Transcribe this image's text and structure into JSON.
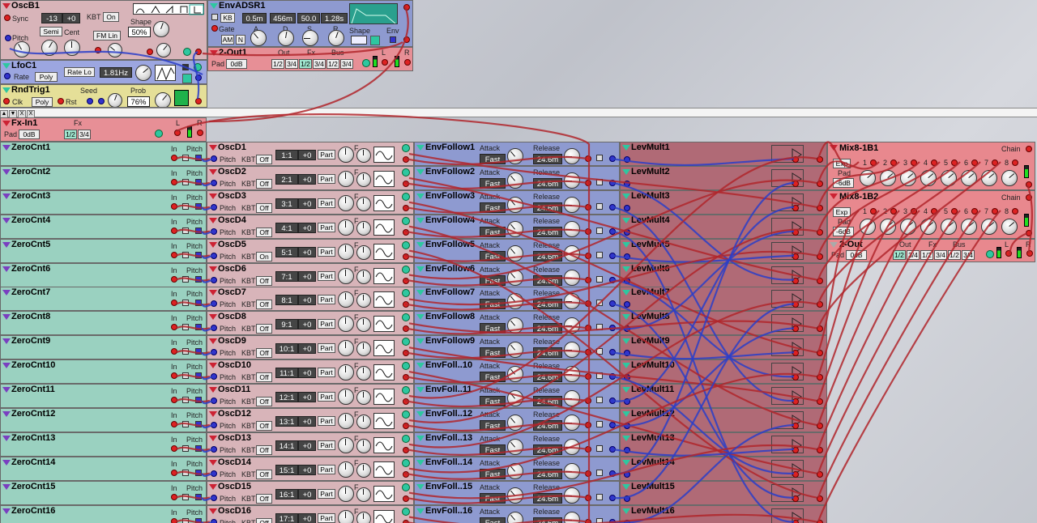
{
  "colors": {
    "osc": "#d8b4b9",
    "env": "#8e9ad0",
    "lfo": "#9ca6e0",
    "rnd": "#e5df98",
    "out": "#e78f96",
    "zero": "#9ad1c0",
    "follow": "#8e9ad0",
    "lev": "#b06a76",
    "mix": "#e8888e",
    "cable_red": "#b0262c",
    "cable_blue": "#2b3ec8"
  },
  "oscb1": {
    "title": "OscB1",
    "sync": "Sync",
    "coarse": "-13",
    "fine": "+0",
    "kbt": "KBT",
    "kbt_val": "On",
    "shape": "Shape",
    "shape_val": "50%",
    "semi": "Semi",
    "cent": "Cent",
    "pitch": "Pitch",
    "fm": "FM Lin"
  },
  "envadsr1": {
    "title": "EnvADSR1",
    "kb": "KB",
    "attack": "0.5m",
    "decay": "456m",
    "sustain": "50.0",
    "release": "1.28s",
    "gate": "Gate",
    "a": "A",
    "d": "D",
    "s": "S",
    "r": "R",
    "am": "AM",
    "n": "N",
    "shape": "Shape",
    "env": "Env"
  },
  "out2": {
    "title": "2-Out1",
    "pad": "Pad",
    "pad_val": "0dB",
    "out": "Out",
    "fx": "Fx",
    "bus": "Bus",
    "o12": "1/2",
    "o34": "3/4",
    "f12": "1/2",
    "f34": "3/4",
    "b12": "1/2",
    "b34": "3/4",
    "l": "L",
    "r": "R"
  },
  "lfoc1": {
    "title": "LfoC1",
    "rate": "Rate",
    "poly": "Poly",
    "ratelo": "Rate Lo",
    "freq": "1.81Hz"
  },
  "rndtrig1": {
    "title": "RndTrig1",
    "seed": "Seed",
    "prob": "Prob",
    "clk": "Clk",
    "poly": "Poly",
    "rst": "Rst",
    "prob_val": "76%"
  },
  "toolbar": {
    "b1": "▲",
    "b2": "▼",
    "b3": "X",
    "b4": "X"
  },
  "fxin": {
    "title": "Fx-In1",
    "fx": "Fx",
    "pad": "Pad",
    "pad_val": "0dB",
    "f12": "1/2",
    "f34": "3/4",
    "l": "L",
    "r": "R"
  },
  "rows": [
    {
      "zero": "ZeroCnt1",
      "osc": "OscD1",
      "ratio": "1:1",
      "fine": "+0",
      "kbt": "Off",
      "ef": "EnvFollow1",
      "lev": "LevMult1"
    },
    {
      "zero": "ZeroCnt2",
      "osc": "OscD2",
      "ratio": "2:1",
      "fine": "+0",
      "kbt": "Off",
      "ef": "EnvFollow2",
      "lev": "LevMult2"
    },
    {
      "zero": "ZeroCnt3",
      "osc": "OscD3",
      "ratio": "3:1",
      "fine": "+0",
      "kbt": "Off",
      "ef": "EnvFollow3",
      "lev": "LevMult3"
    },
    {
      "zero": "ZeroCnt4",
      "osc": "OscD4",
      "ratio": "4:1",
      "fine": "+0",
      "kbt": "Off",
      "ef": "EnvFollow4",
      "lev": "LevMult4"
    },
    {
      "zero": "ZeroCnt5",
      "osc": "OscD5",
      "ratio": "5:1",
      "fine": "+0",
      "kbt": "On",
      "ef": "EnvFollow5",
      "lev": "LevMult5"
    },
    {
      "zero": "ZeroCnt6",
      "osc": "OscD6",
      "ratio": "7:1",
      "fine": "+0",
      "kbt": "Off",
      "ef": "EnvFollow6",
      "lev": "LevMult6"
    },
    {
      "zero": "ZeroCnt7",
      "osc": "OscD7",
      "ratio": "8:1",
      "fine": "+0",
      "kbt": "Off",
      "ef": "EnvFollow7",
      "lev": "LevMult7"
    },
    {
      "zero": "ZeroCnt8",
      "osc": "OscD8",
      "ratio": "9:1",
      "fine": "+0",
      "kbt": "Off",
      "ef": "EnvFollow8",
      "lev": "LevMult8"
    },
    {
      "zero": "ZeroCnt9",
      "osc": "OscD9",
      "ratio": "10:1",
      "fine": "+0",
      "kbt": "Off",
      "ef": "EnvFollow9",
      "lev": "LevMult9"
    },
    {
      "zero": "ZeroCnt10",
      "osc": "OscD10",
      "ratio": "11:1",
      "fine": "+0",
      "kbt": "Off",
      "ef": "EnvFoll..10",
      "lev": "LevMult10"
    },
    {
      "zero": "ZeroCnt11",
      "osc": "OscD11",
      "ratio": "12:1",
      "fine": "+0",
      "kbt": "Off",
      "ef": "EnvFoll..11",
      "lev": "LevMult11"
    },
    {
      "zero": "ZeroCnt12",
      "osc": "OscD12",
      "ratio": "13:1",
      "fine": "+0",
      "kbt": "Off",
      "ef": "EnvFoll..12",
      "lev": "LevMult12"
    },
    {
      "zero": "ZeroCnt13",
      "osc": "OscD13",
      "ratio": "14:1",
      "fine": "+0",
      "kbt": "Off",
      "ef": "EnvFoll..13",
      "lev": "LevMult13"
    },
    {
      "zero": "ZeroCnt14",
      "osc": "OscD14",
      "ratio": "15:1",
      "fine": "+0",
      "kbt": "Off",
      "ef": "EnvFoll..14",
      "lev": "LevMult14"
    },
    {
      "zero": "ZeroCnt15",
      "osc": "OscD15",
      "ratio": "16:1",
      "fine": "+0",
      "kbt": "Off",
      "ef": "EnvFoll..15",
      "lev": "LevMult15"
    },
    {
      "zero": "ZeroCnt16",
      "osc": "OscD16",
      "ratio": "17:1",
      "fine": "+0",
      "kbt": "Off",
      "ef": "EnvFoll..16",
      "lev": "LevMult16"
    }
  ],
  "row_labels": {
    "in": "In",
    "pitch": "Pitch",
    "part": "Part",
    "kbt": "KBT",
    "attack": "Attack",
    "release": "Release",
    "fast": "Fast",
    "release_val": "24.6m",
    "f": "F"
  },
  "mix1": {
    "title": "Mix8-1B1",
    "chain": "Chain",
    "exp": "Exp",
    "pad": "Pad",
    "pad_val": "-6dB",
    "n1": "1",
    "n2": "2",
    "n3": "3",
    "n4": "4",
    "n5": "5",
    "n6": "6",
    "n7": "7",
    "n8": "8"
  },
  "mix2": {
    "title": "Mix8-1B2",
    "chain": "Chain",
    "exp": "Exp",
    "pad": "Pad",
    "pad_val": "-6dB",
    "n1": "1",
    "n2": "2",
    "n3": "3",
    "n4": "4",
    "n5": "5",
    "n6": "6",
    "n7": "7",
    "n8": "8"
  },
  "out3": {
    "title": "2-Out",
    "pad": "Pad",
    "pad_val": "0dB",
    "out": "Out",
    "fx": "Fx",
    "bus": "Bus",
    "o12": "1/2",
    "o34": "3/4",
    "f12": "1/2",
    "f34": "3/4",
    "b12": "1/2",
    "b34": "3/4",
    "l": "L",
    "r": "R"
  }
}
